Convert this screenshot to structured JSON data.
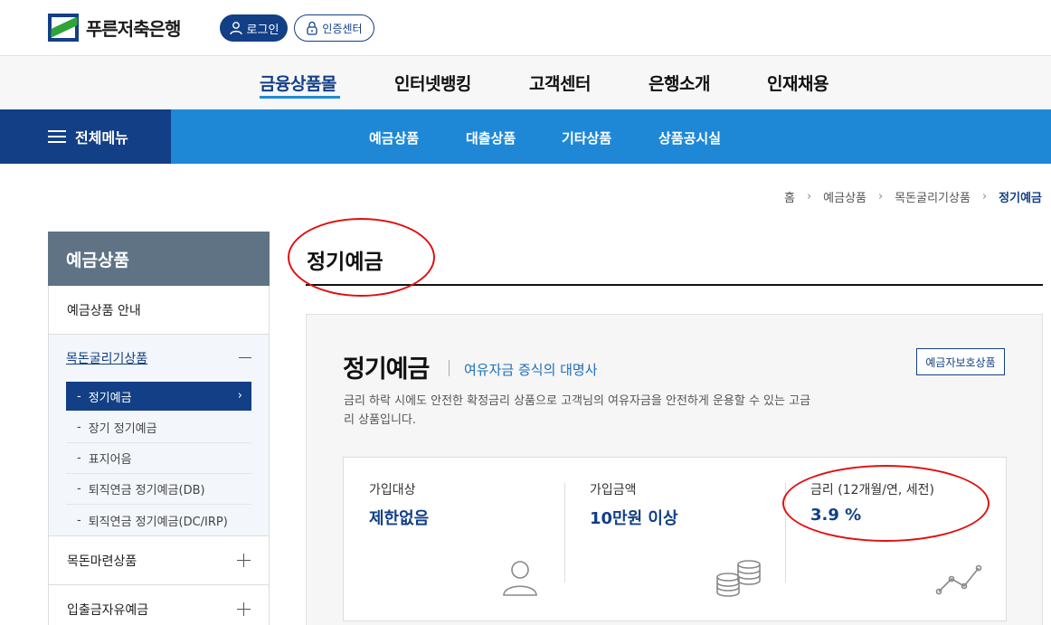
{
  "header": {
    "logo_text": "푸른저축은행",
    "login_label": "로그인",
    "cert_label": "인증센터"
  },
  "gnb": {
    "items": [
      {
        "label": "금융상품몰",
        "active": true
      },
      {
        "label": "인터넷뱅킹"
      },
      {
        "label": "고객센터"
      },
      {
        "label": "은행소개"
      },
      {
        "label": "인재채용"
      }
    ]
  },
  "subnav": {
    "all_menu_label": "전체메뉴",
    "items": [
      "예금상품",
      "대출상품",
      "기타상품",
      "상품공시실"
    ]
  },
  "breadcrumb": [
    "홈",
    "예금상품",
    "목돈굴리기상품",
    "정기예금"
  ],
  "lnb": {
    "title": "예금상품",
    "row1": "예금상품 안내",
    "group_title": "목돈굴리기상품",
    "group_items": [
      "정기예금",
      "장기 정기예금",
      "표지어음",
      "퇴직연금 정기예금(DB)",
      "퇴직연금 정기예금(DC/IRP)"
    ],
    "row2": "목돈마련상품",
    "row3": "입출금자유예금"
  },
  "page": {
    "title": "정기예금"
  },
  "product": {
    "title": "정기예금",
    "subtitle": "여유자금 증식의 대명사",
    "description": "금리 하락 시에도 안전한 확정금리 상품으로 고객님의 여유자금을 안전하게 운용할 수 있는 고금리 상품입니다.",
    "badge": "예금자보호상품",
    "info": [
      {
        "label": "가입대상",
        "value": "제한없음",
        "icon": "person-icon"
      },
      {
        "label": "가입금액",
        "value": "10만원 이상",
        "icon": "coins-icon"
      },
      {
        "label": "금리 (12개월/연, 세전)",
        "value": "3.9 %",
        "icon": "line-chart-icon"
      }
    ]
  },
  "colors": {
    "navy": "#123f86",
    "blue": "#1e88d6",
    "slate": "#5f7385",
    "annotation_red": "#e01010"
  }
}
